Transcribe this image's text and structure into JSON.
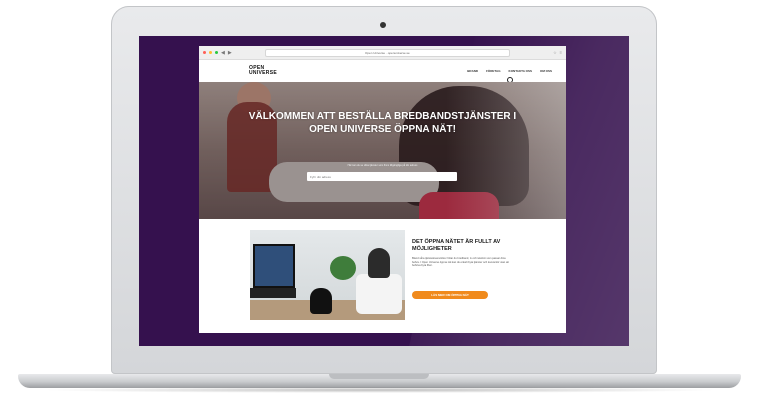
{
  "browser": {
    "address": "Open Universe · openuniverse.se",
    "colors": {
      "close": "#ff5f57",
      "minimize": "#ffbd2e",
      "maximize": "#28c840"
    }
  },
  "site": {
    "logo_line1": "OPEN",
    "logo_line2": "UNIVERSE",
    "nav": [
      "BRAND",
      "FÖRETAG",
      "KONTAKTA OSS",
      "OM OSS"
    ],
    "search_icon": "search-icon"
  },
  "hero": {
    "title": "VÄLKOMMEN ATT BESTÄLLA BREDBANDSTJÄNSTER I OPEN UNIVERSE ÖPPNA NÄT!",
    "subtitle": "Här kan du se vilka tjänster som finns tillgängliga på din adress",
    "input_placeholder": "Fyll i din adress"
  },
  "promo": {
    "title": "DET ÖPPNA NÄTET ÄR FULLT AV MÖJLIGHETER",
    "body": "Bland våra tjänsteleverantörer hittar du bredband, tv och telefoni som passar dina behov. I Open Universe öppna nät kan du enkelt byta tjänster och leverantör utan att behöva byta fiber.",
    "button": "LÄS MER OM ÖPPNA NÄT"
  },
  "colors": {
    "screen_bg": "#35114e",
    "accent": "#f08a1c"
  }
}
